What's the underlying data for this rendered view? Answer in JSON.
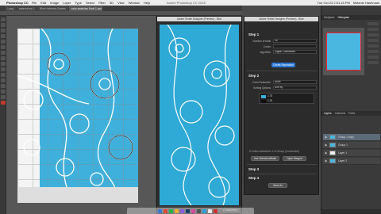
{
  "menubar": {
    "app_name": "Photoshop CC",
    "items": [
      "File",
      "Edit",
      "Image",
      "Layer",
      "Type",
      "Select",
      "Filter",
      "3D",
      "View",
      "Window",
      "Help"
    ],
    "window_title": "Adobe Photoshop CC 2018",
    "clock": "Tue Oct 23  2:51:18 PM",
    "user": "Melanie Hashmani"
  },
  "tabs": [
    {
      "label": "1.png"
    },
    {
      "label": "watercolors-1"
    },
    {
      "label": "Blue Hortensia-Scenes"
    },
    {
      "label": "color-swatches Book 1-psd @ 10% (Group 1 copy, RGB/8)"
    }
  ],
  "pattern_window": {
    "title": "Adobe Textile Designer (Preview) - Blue",
    "status_zoom": "2.75%",
    "status_btn": "Go Fullscreen"
  },
  "dialog": {
    "title": "Adobe Textile Designer (Preview) - Blue",
    "step1": "Step 1",
    "rows1": [
      {
        "label": "Number of trials",
        "value": "16"
      },
      {
        "label": "Colors",
        "value": ""
      },
      {
        "label": "Algorithm",
        "value": "Digital Collectibles"
      }
    ],
    "create_btn": "Create Separation",
    "step2": "Step 2",
    "rows2": [
      {
        "label": "Color Reduction",
        "value": "None"
      },
      {
        "label": "Sorting Options",
        "value": "Sort by"
      }
    ],
    "swatch_text_a": "1.75",
    "swatch_text_b": "1.25",
    "step3_note": "0 Colors selected in 1 of Group (Conversion)",
    "merge_btn": "Use Selection/Mask",
    "merge_btn2": "Open Merged",
    "step3": "Step 3",
    "step4": "Step 4",
    "save_btn": "Save As"
  },
  "right_panel": {
    "tabs": [
      "Navigator",
      "Histogram"
    ],
    "layer_tabs": [
      "Layers",
      "Channels",
      "Paths"
    ],
    "layers": [
      {
        "name": "Group 1 copy",
        "selected": true
      },
      {
        "name": "Group 1",
        "selected": false
      },
      {
        "name": "Layer 1",
        "selected": false
      },
      {
        "name": "Layer 2",
        "selected": false
      }
    ]
  },
  "colors": {
    "pattern_blue": "#3fb0dc",
    "accent_blue": "#2d7ad6",
    "selection_red": "#e22233"
  }
}
